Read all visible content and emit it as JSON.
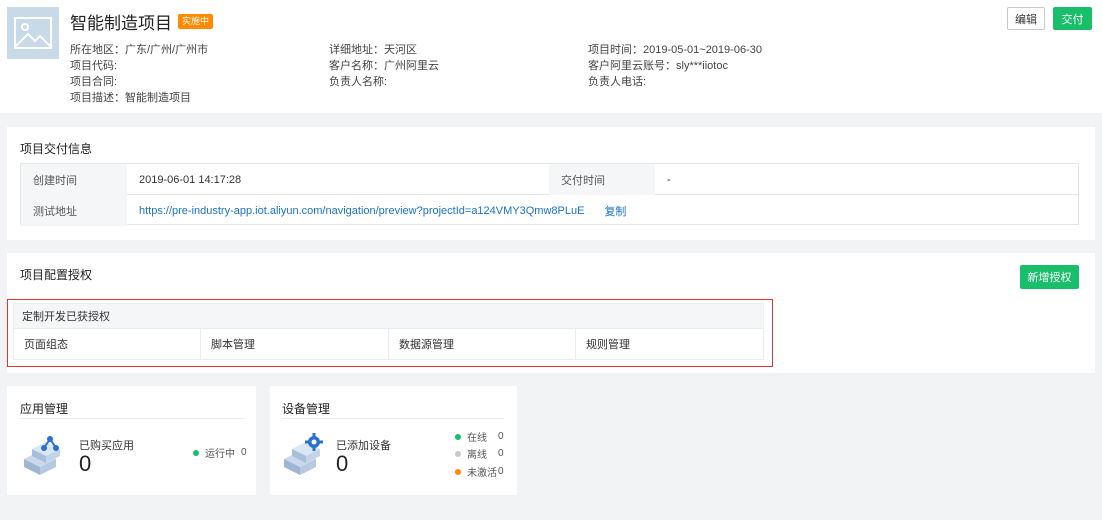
{
  "project": {
    "title": "智能制造项目",
    "status_badge": "实施中",
    "meta": {
      "region": "所在地区：广东/广州/广州市",
      "address": "详细地址：天河区",
      "time": "项目时间：2019-05-01~2019-06-30",
      "code": "项目代码:",
      "customer_name": "客户名称：广州阿里云",
      "customer_account": "客户阿里云账号：sly***iiotoc",
      "contract": "项目合同:",
      "owner_name": "负责人名称:",
      "owner_phone": "负责人电话:",
      "description": "项目描述：智能制造项目"
    },
    "actions": {
      "edit": "编辑",
      "deliver": "交付"
    }
  },
  "delivery": {
    "title": "项目交付信息",
    "created_label": "创建时间",
    "created_value": "2019-06-01 14:17:28",
    "delivered_label": "交付时间",
    "delivered_value": "-",
    "test_label": "测试地址",
    "test_url": "https://pre-industry-app.iot.aliyun.com/navigation/preview?projectId=a124VMY3Qmw8PLuE",
    "copy_label": "复制"
  },
  "auth": {
    "title": "项目配置授权",
    "add_button": "新增授权",
    "group_title": "定制开发已获授权",
    "items": [
      "页面组态",
      "脚本管理",
      "数据源管理",
      "规则管理"
    ]
  },
  "apps": {
    "title": "应用管理",
    "purchased_label": "已购买应用",
    "purchased_count": "0",
    "running_label": "运行中",
    "running_count": "0",
    "running_color": "#19be6b"
  },
  "devices": {
    "title": "设备管理",
    "added_label": "已添加设备",
    "added_count": "0",
    "online_label": "在线",
    "online_count": "0",
    "offline_label": "离线",
    "offline_count": "0",
    "inactive_label": "未激活",
    "inactive_count": "0",
    "colors": {
      "online": "#19be6b",
      "offline": "#c8c8c8",
      "inactive": "#ff8a00"
    }
  }
}
